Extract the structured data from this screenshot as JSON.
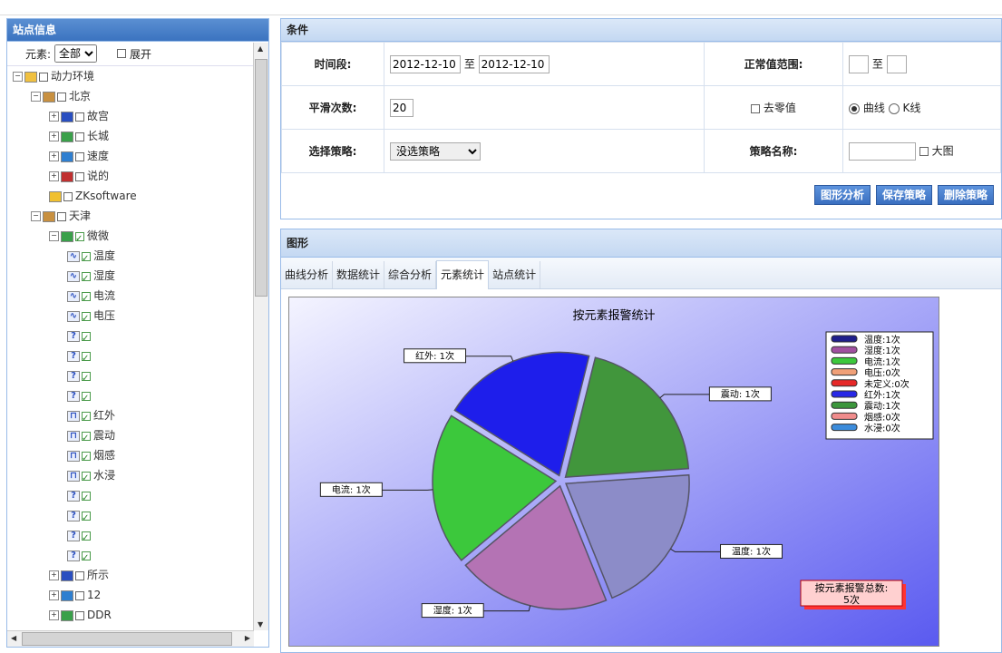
{
  "left_panel": {
    "title": "站点信息",
    "filter": {
      "label": "元素:",
      "selected": "全部",
      "expand_label": "展开"
    },
    "tree": [
      {
        "label": "动力环境",
        "depth": 0,
        "icon": "home-icon",
        "pm": "-",
        "checked": false
      },
      {
        "label": "北京",
        "depth": 1,
        "icon": "building-icon",
        "pm": "-",
        "checked": false
      },
      {
        "label": "故宫",
        "depth": 2,
        "icon": "camera-icon",
        "pm": "+",
        "checked": false
      },
      {
        "label": "长城",
        "depth": 2,
        "icon": "image-icon",
        "pm": "+",
        "checked": false
      },
      {
        "label": "速度",
        "depth": 2,
        "icon": "globe-icon",
        "pm": "+",
        "checked": false
      },
      {
        "label": "说的",
        "depth": 2,
        "icon": "book-icon",
        "pm": "+",
        "checked": false
      },
      {
        "label": "ZKsoftware",
        "depth": 2,
        "icon": "lock-icon",
        "pm": "",
        "checked": false
      },
      {
        "label": "天津",
        "depth": 1,
        "icon": "building-icon",
        "pm": "-",
        "checked": false
      },
      {
        "label": "微微",
        "depth": 2,
        "icon": "image-icon",
        "pm": "-",
        "checked": true
      },
      {
        "label": "温度",
        "depth": 3,
        "icon": "wave-icon",
        "pm": "",
        "checked": true
      },
      {
        "label": "湿度",
        "depth": 3,
        "icon": "wave-icon",
        "pm": "",
        "checked": true
      },
      {
        "label": "电流",
        "depth": 3,
        "icon": "wave-icon",
        "pm": "",
        "checked": true
      },
      {
        "label": "电压",
        "depth": 3,
        "icon": "wave-icon",
        "pm": "",
        "checked": true
      },
      {
        "label": "",
        "depth": 3,
        "icon": "question-icon",
        "pm": "",
        "checked": true
      },
      {
        "label": "",
        "depth": 3,
        "icon": "question-icon",
        "pm": "",
        "checked": true
      },
      {
        "label": "",
        "depth": 3,
        "icon": "question-icon",
        "pm": "",
        "checked": true
      },
      {
        "label": "",
        "depth": 3,
        "icon": "question-icon",
        "pm": "",
        "checked": true
      },
      {
        "label": "红外",
        "depth": 3,
        "icon": "pulse-icon",
        "pm": "",
        "checked": true
      },
      {
        "label": "震动",
        "depth": 3,
        "icon": "pulse-icon",
        "pm": "",
        "checked": true
      },
      {
        "label": "烟感",
        "depth": 3,
        "icon": "pulse-icon",
        "pm": "",
        "checked": true
      },
      {
        "label": "水浸",
        "depth": 3,
        "icon": "pulse-icon",
        "pm": "",
        "checked": true
      },
      {
        "label": "",
        "depth": 3,
        "icon": "question-icon",
        "pm": "",
        "checked": true
      },
      {
        "label": "",
        "depth": 3,
        "icon": "question-icon",
        "pm": "",
        "checked": true
      },
      {
        "label": "",
        "depth": 3,
        "icon": "question-icon",
        "pm": "",
        "checked": true
      },
      {
        "label": "",
        "depth": 3,
        "icon": "question-icon",
        "pm": "",
        "checked": true
      },
      {
        "label": "所示",
        "depth": 2,
        "icon": "camera-icon",
        "pm": "+",
        "checked": false
      },
      {
        "label": "12",
        "depth": 2,
        "icon": "globe-icon",
        "pm": "+",
        "checked": false
      },
      {
        "label": "DDR",
        "depth": 2,
        "icon": "image-icon",
        "pm": "+",
        "checked": false
      }
    ]
  },
  "conditions": {
    "title": "条件",
    "time_label": "时间段:",
    "start_date": "2012-12-10",
    "to_label": "至",
    "end_date": "2012-12-10",
    "normal_label": "正常值范围:",
    "normal_to": "至",
    "smooth_label": "平滑次数:",
    "smooth_value": "20",
    "zero_label": "去零值",
    "curve_label": "曲线",
    "kline_label": "K线",
    "strategy_label": "选择策略:",
    "strategy_selected": "没选策略",
    "strategy_name_label": "策略名称:",
    "bigfig_label": "大图",
    "buttons": {
      "analyze": "图形分析",
      "save": "保存策略",
      "delete": "删除策略"
    }
  },
  "figure": {
    "title": "图形",
    "tabs": [
      "曲线分析",
      "数据统计",
      "综合分析",
      "元素统计",
      "站点统计"
    ],
    "active_tab": 3
  },
  "chart_data": {
    "type": "pie",
    "title": "按元素报警统计",
    "slices": [
      {
        "name": "温度",
        "value": 1,
        "label": "温度: 1次",
        "color": "#8c8cc8"
      },
      {
        "name": "湿度",
        "value": 1,
        "label": "湿度: 1次",
        "color": "#b473b4"
      },
      {
        "name": "电流",
        "value": 1,
        "label": "电流: 1次",
        "color": "#3cc83c"
      },
      {
        "name": "红外",
        "value": 1,
        "label": "红外: 1次",
        "color": "#1e1eeb"
      },
      {
        "name": "震动",
        "value": 1,
        "label": "震动: 1次",
        "color": "#41963c"
      }
    ],
    "legend": [
      {
        "text": "温度:1次",
        "color": "#1e1e8c"
      },
      {
        "text": "湿度:1次",
        "color": "#a050a0"
      },
      {
        "text": "电流:1次",
        "color": "#3cc83c"
      },
      {
        "text": "电压:0次",
        "color": "#f0a078"
      },
      {
        "text": "未定义:0次",
        "color": "#e62828"
      },
      {
        "text": "红外:1次",
        "color": "#2828e6"
      },
      {
        "text": "震动:1次",
        "color": "#3c963c"
      },
      {
        "text": "烟感:0次",
        "color": "#f08c8c"
      },
      {
        "text": "水浸:0次",
        "color": "#3c8cdc"
      }
    ],
    "legend_position": "top-right",
    "total_label": "按元素报警总数:",
    "total_value": "5次"
  }
}
